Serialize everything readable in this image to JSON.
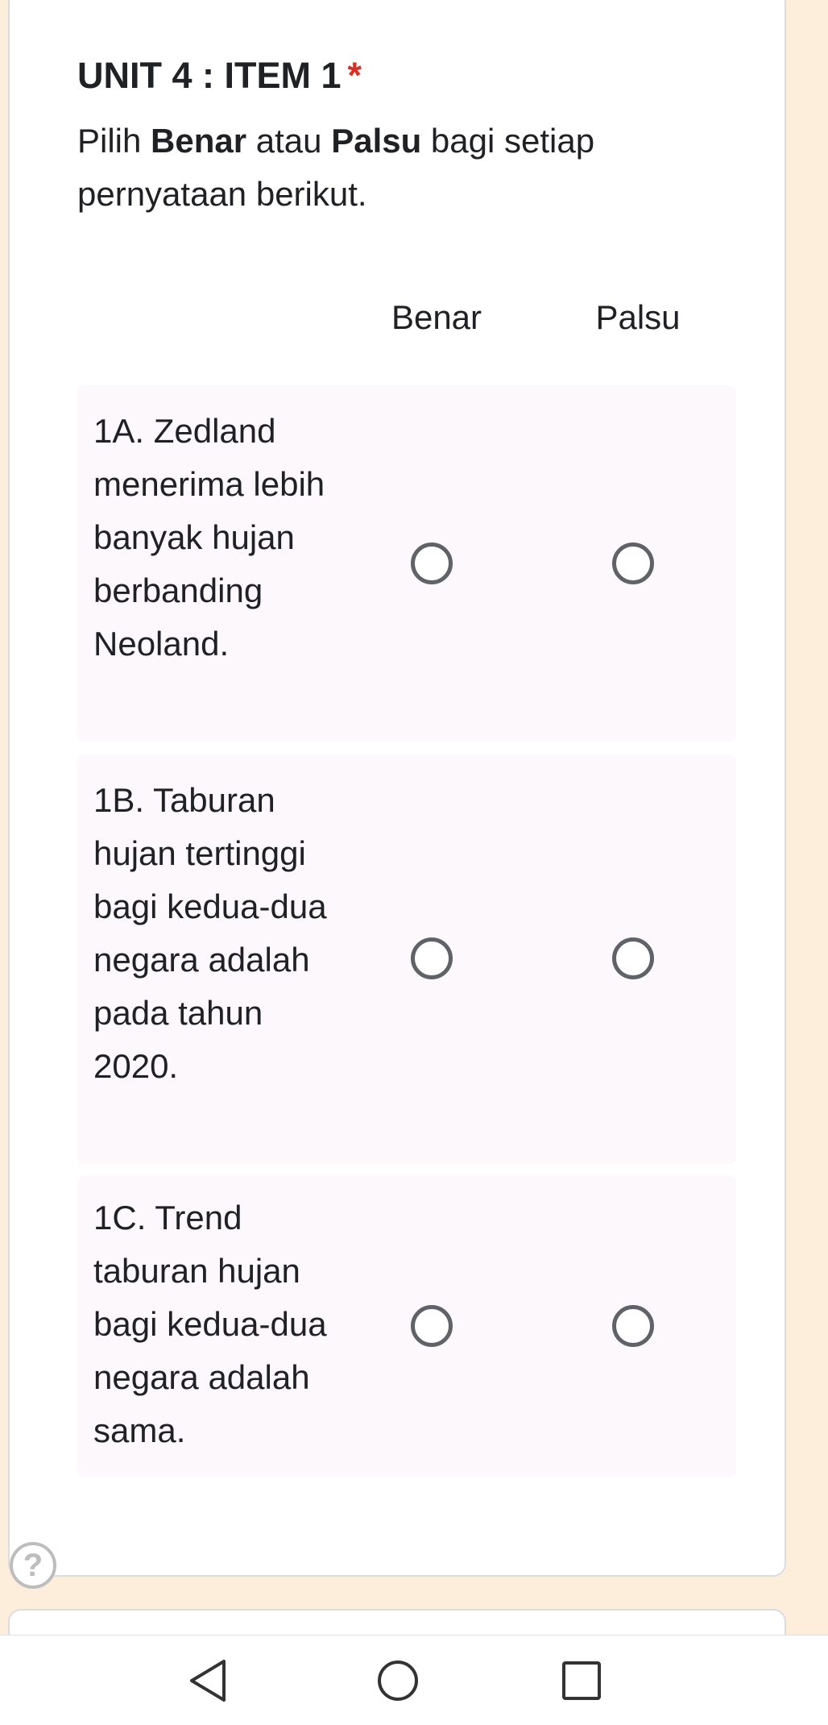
{
  "question": {
    "title": "UNIT 4 : ITEM 1",
    "required_mark": "*",
    "description": {
      "prefix": "Pilih ",
      "option_true": "Benar",
      "middle": " atau ",
      "option_false": "Palsu",
      "suffix": " bagi setiap pernyataan berikut."
    },
    "columns": [
      "Benar",
      "Palsu"
    ],
    "rows": [
      {
        "label": "1A. Zedland menerima lebih banyak hujan berbanding Neoland.",
        "selected": null
      },
      {
        "label": "1B. Taburan hujan tertinggi bagi kedua-dua negara adalah pada tahun 2020.",
        "selected": null
      },
      {
        "label": "1C. Trend taburan hujan bagi kedua-dua negara adalah sama.",
        "selected": null
      }
    ]
  },
  "help": {
    "icon": "help-icon",
    "glyph": "?"
  },
  "navbar": {
    "back_icon": "back-triangle-icon",
    "home_icon": "home-circle-icon",
    "recent_icon": "recent-square-icon"
  },
  "colors": {
    "page_background": "#fdeedc",
    "card_background": "#ffffff",
    "row_background": "#fcf8fc",
    "required": "#d93025",
    "radio_border": "#5f6368"
  }
}
